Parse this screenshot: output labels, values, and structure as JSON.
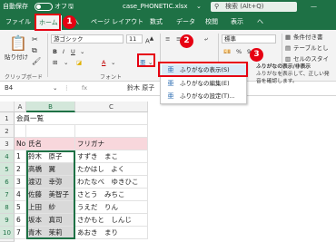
{
  "titlebar": {
    "autosave_label": "自動保存",
    "autosave_state": "オフ",
    "filename": "case_PHONETIC.xlsx",
    "search_placeholder": "検索 (Alt+Q)"
  },
  "tabs": [
    {
      "label": "ファイル"
    },
    {
      "label": "ホーム",
      "active": true
    },
    {
      "label": "挿入"
    },
    {
      "label": "ページ レイアウト"
    },
    {
      "label": "数式"
    },
    {
      "label": "データ"
    },
    {
      "label": "校閲"
    },
    {
      "label": "表示"
    },
    {
      "label": "ヘ"
    }
  ],
  "ribbon": {
    "paste_label": "貼り付け",
    "clipboard_group": "クリップボード",
    "font_name": "游ゴシック",
    "font_size": "11",
    "font_group": "フォント",
    "number_format": "標準",
    "styles": [
      "条件付き書",
      "テーブルとし",
      "セルのスタイ"
    ]
  },
  "menu": {
    "items": [
      {
        "label": "ふりがなの表示(S)",
        "icon": "furigana-show-icon",
        "highlighted": true
      },
      {
        "label": "ふりがなの編集(E)",
        "icon": "furigana-edit-icon"
      },
      {
        "label": "ふりがなの設定(T)...",
        "icon": "furigana-settings-icon"
      }
    ]
  },
  "tooltip": {
    "title": "ふりがなの表示/非表示",
    "body": "ふりがなを表示して、正しい発音を確認します。"
  },
  "formula_bar": {
    "name_box": "B4",
    "value": "鈴木 原子"
  },
  "sheet": {
    "columns": [
      "A",
      "B",
      "C"
    ],
    "rows": [
      {
        "n": "1",
        "a": "会員一覧",
        "b": "",
        "c": ""
      },
      {
        "n": "2",
        "a": "",
        "b": "",
        "c": ""
      },
      {
        "n": "3",
        "a": "No",
        "b": "氏名",
        "c": "フリガナ"
      },
      {
        "n": "4",
        "a": "1",
        "b": "鈴木　原子",
        "c": "すずき　まこ"
      },
      {
        "n": "5",
        "a": "2",
        "b": "高橋　翼",
        "c": "たかはし　よく"
      },
      {
        "n": "6",
        "a": "3",
        "b": "渡辺　幸弥",
        "c": "わたなべ　ゆきひこ"
      },
      {
        "n": "7",
        "a": "4",
        "b": "佐藤　美智子",
        "c": "さとう　みちこ"
      },
      {
        "n": "8",
        "a": "5",
        "b": "上田　紗",
        "c": "うえだ　りん"
      },
      {
        "n": "9",
        "a": "6",
        "b": "坂本　真司",
        "c": "さかもと　しんじ"
      },
      {
        "n": "10",
        "a": "7",
        "b": "青木　茉莉",
        "c": "あおき　まり"
      },
      {
        "n": "11",
        "a": "",
        "b": "",
        "c": ""
      }
    ]
  },
  "callouts": [
    "1",
    "2",
    "3"
  ],
  "colors": {
    "excel_green": "#1e7145",
    "callout_red": "#e60012",
    "header_fill": "#f8d7dc"
  }
}
